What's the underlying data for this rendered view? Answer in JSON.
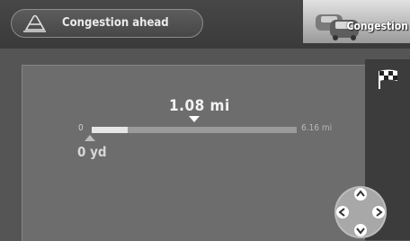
{
  "header": {
    "message": "Congestion ahead",
    "message_icon": "traffic-cone-icon",
    "tab_label": "Congestion",
    "tab_icon": "cars-icon"
  },
  "route": {
    "distance_ahead": "1.08 mi",
    "start_label": "0",
    "end_label": "6.16 mi",
    "start_distance": "0 yd",
    "progress_fraction": 0.175
  },
  "controls": {
    "destination_icon": "checkered-flag-icon",
    "dpad_icon": "directional-pad-icon"
  },
  "colors": {
    "background": "#555555",
    "panel": "#6d6d6d",
    "bar_filled": "#e6e6e6",
    "bar_remaining": "#9a9a9a"
  }
}
